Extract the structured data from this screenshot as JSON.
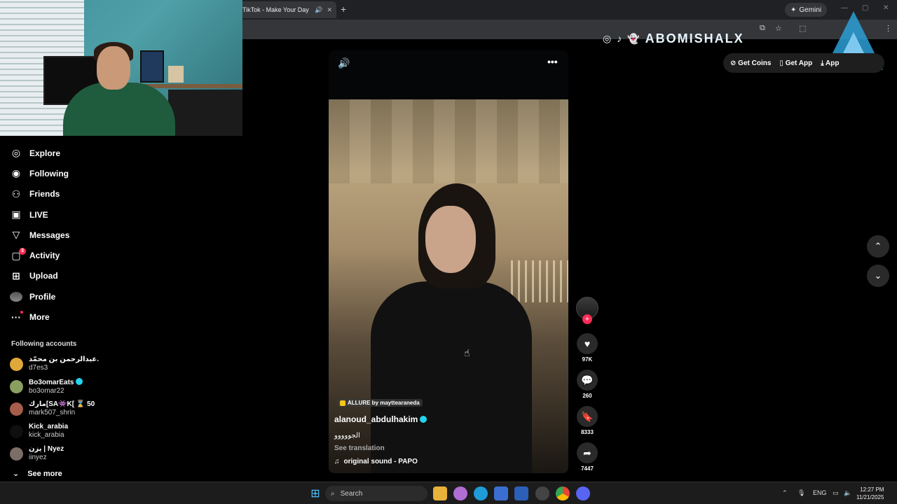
{
  "browser": {
    "tab_title": "TikTok - Make Your Day",
    "gemini_label": "Gemini"
  },
  "nav": {
    "items": [
      {
        "label": "Explore",
        "icon": "compass-icon"
      },
      {
        "label": "Following",
        "icon": "following-avatar-icon"
      },
      {
        "label": "Friends",
        "icon": "friends-icon"
      },
      {
        "label": "LIVE",
        "icon": "live-icon"
      },
      {
        "label": "Messages",
        "icon": "messages-icon"
      },
      {
        "label": "Activity",
        "icon": "activity-icon",
        "badge": "3"
      },
      {
        "label": "Upload",
        "icon": "upload-icon"
      },
      {
        "label": "Profile",
        "icon": "profile-avatar"
      },
      {
        "label": "More",
        "icon": "more-icon"
      }
    ]
  },
  "following": {
    "header": "Following accounts",
    "accounts": [
      {
        "name": "عبدالرحمن بن محمّد.",
        "username": "d7es3",
        "verified": false,
        "avatar_color": "#e0a73a"
      },
      {
        "name": "Bo3omarEats",
        "username": "bo3omar22",
        "verified": true,
        "avatar_color": "#8aa060"
      },
      {
        "name": "مارك[SA👾K[ ⌛ 50",
        "username": "mark507_shrin",
        "verified": false,
        "avatar_color": "#a65d4a"
      },
      {
        "name": "Kick_arabia",
        "username": "kick_arabia",
        "verified": false,
        "avatar_color": "#0f0f0f"
      },
      {
        "name": "يزن | Nyez",
        "username": "iinyez",
        "verified": false,
        "avatar_color": "#7b6e66"
      }
    ],
    "see_more": "See more"
  },
  "video": {
    "effect_label": "ALLURE by mayttearaneda",
    "author": "alanoud_abdulhakim",
    "author_verified": true,
    "caption": "الجووووو",
    "see_translation": "See translation",
    "sound": "original sound - PAPO"
  },
  "actions": {
    "likes": "97K",
    "comments": "260",
    "saves": "8333",
    "shares": "7447"
  },
  "top_buttons": {
    "get_coins": "Get Coins",
    "get_app": "Get App",
    "app_partial": "App"
  },
  "banner": {
    "text": "ABOMISHALX"
  },
  "taskbar": {
    "search_placeholder": "Search",
    "language": "ENG",
    "time": "12:27 PM",
    "date": "11/21/2025"
  },
  "colors": {
    "accent": "#fe2c55",
    "verified": "#20d5ec"
  }
}
